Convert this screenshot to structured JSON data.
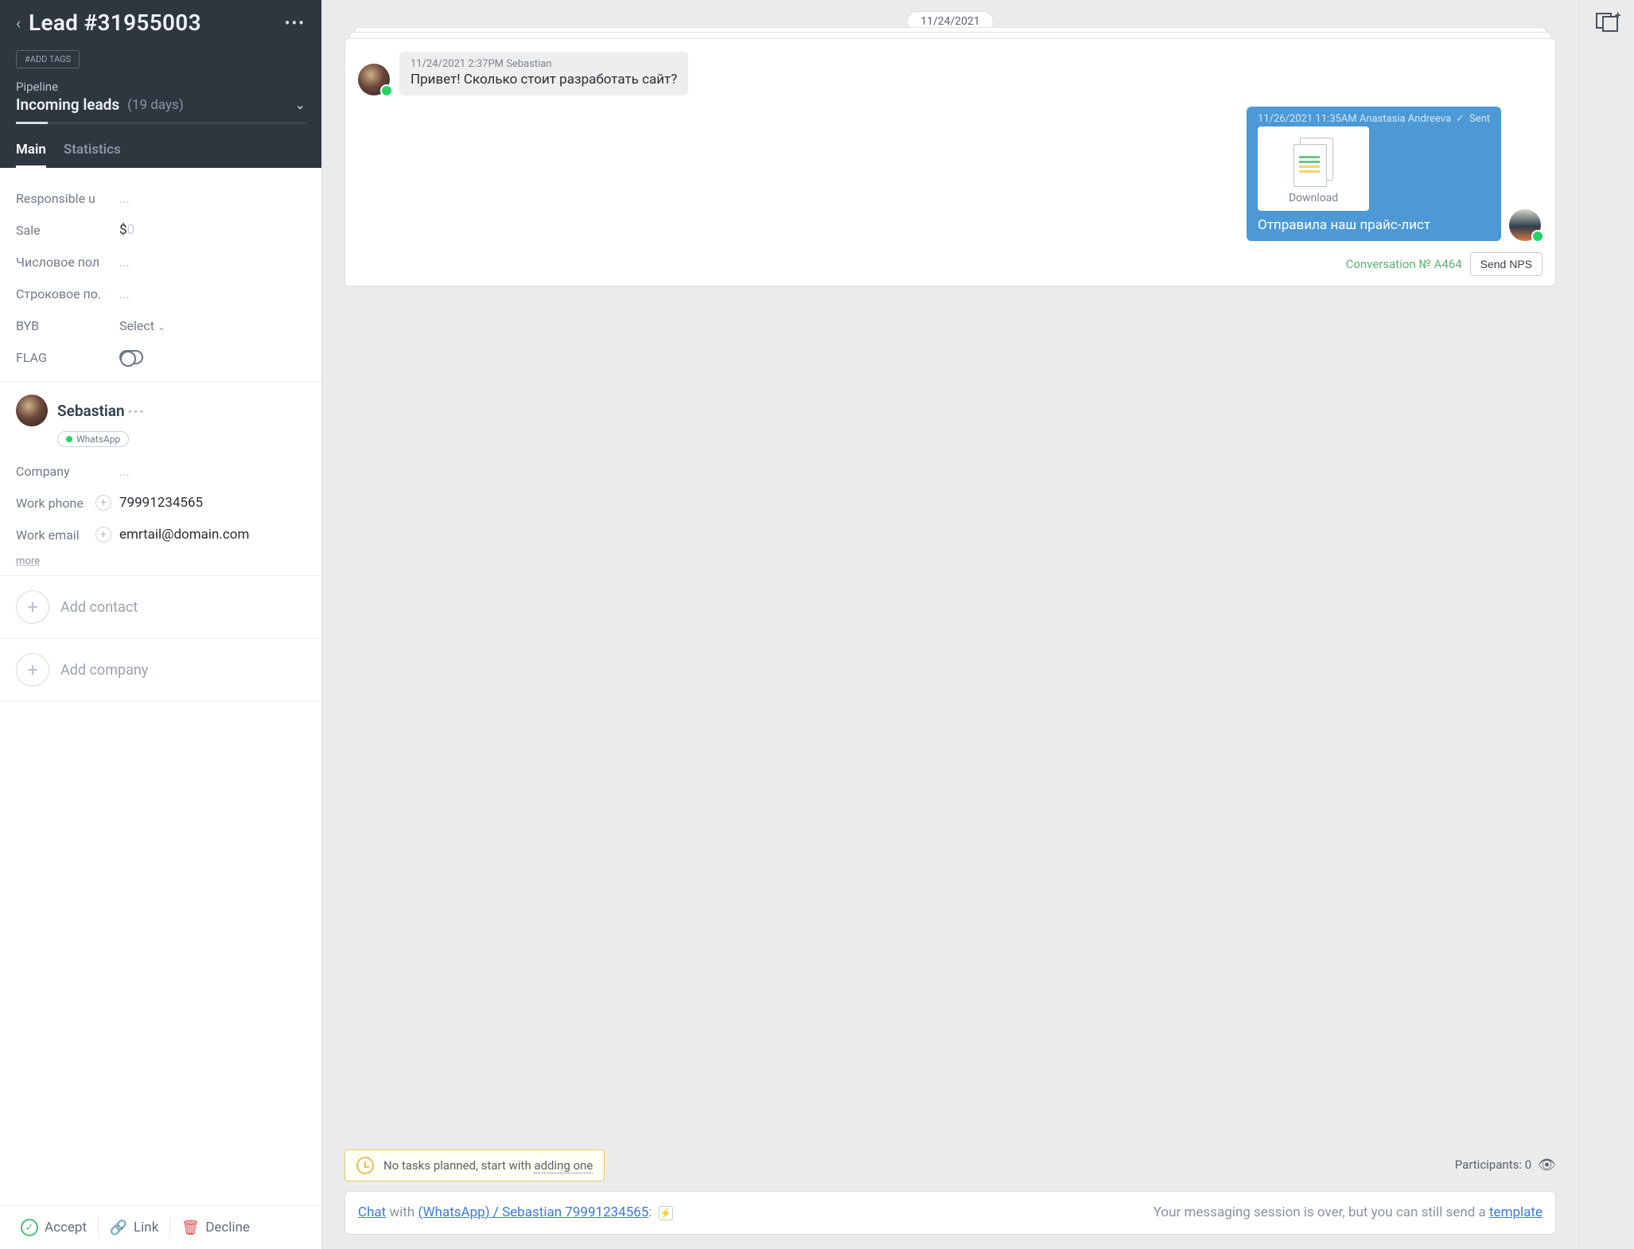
{
  "header": {
    "title": "Lead #31955003",
    "add_tags": "#ADD TAGS",
    "pipeline_label": "Pipeline",
    "stage": "Incoming leads",
    "days": "(19 days)"
  },
  "tabs": {
    "main": "Main",
    "statistics": "Statistics"
  },
  "fields": {
    "responsible_label": "Responsible u",
    "responsible_val": "...",
    "sale_label": "Sale",
    "sale_currency": "$",
    "sale_value": "0",
    "num_label": "Числовое пол",
    "num_val": "...",
    "str_label": "Строковое по.",
    "str_val": "...",
    "byb_label": "BYB",
    "byb_val": "Select",
    "flag_label": "FLAG"
  },
  "contact": {
    "name": "Sebastian",
    "channel": "WhatsApp",
    "company_label": "Company",
    "company_val": "...",
    "phone_label": "Work phone",
    "phone_val": "79991234565",
    "email_label": "Work email",
    "email_val": "emrtail@domain.com",
    "more": "more"
  },
  "add": {
    "contact": "Add contact",
    "company": "Add company"
  },
  "footer": {
    "accept": "Accept",
    "link": "Link",
    "decline": "Decline"
  },
  "feed": {
    "date": "11/24/2021",
    "msg_in": {
      "meta": "11/24/2021 2:37PM Sebastian",
      "text": "Привет! Сколько стоит разработать сайт?"
    },
    "msg_out": {
      "meta": "11/26/2021 11:35AM Anastasia Andreeva",
      "status": "Sent",
      "download": "Download",
      "text": "Отправила наш прайс-лист"
    },
    "conversation_id": "Conversation № A464",
    "send_nps": "Send NPS"
  },
  "tasks": {
    "prefix": "No tasks planned, start with ",
    "link": "adding one"
  },
  "participants": {
    "label": "Participants: ",
    "count": "0"
  },
  "reply": {
    "chat": "Chat",
    "with": " with ",
    "target": "(WhatsApp) / Sebastian 79991234565",
    "colon": ": ",
    "tail1": "Your messaging session is over, but you can still send a ",
    "template": "template"
  }
}
